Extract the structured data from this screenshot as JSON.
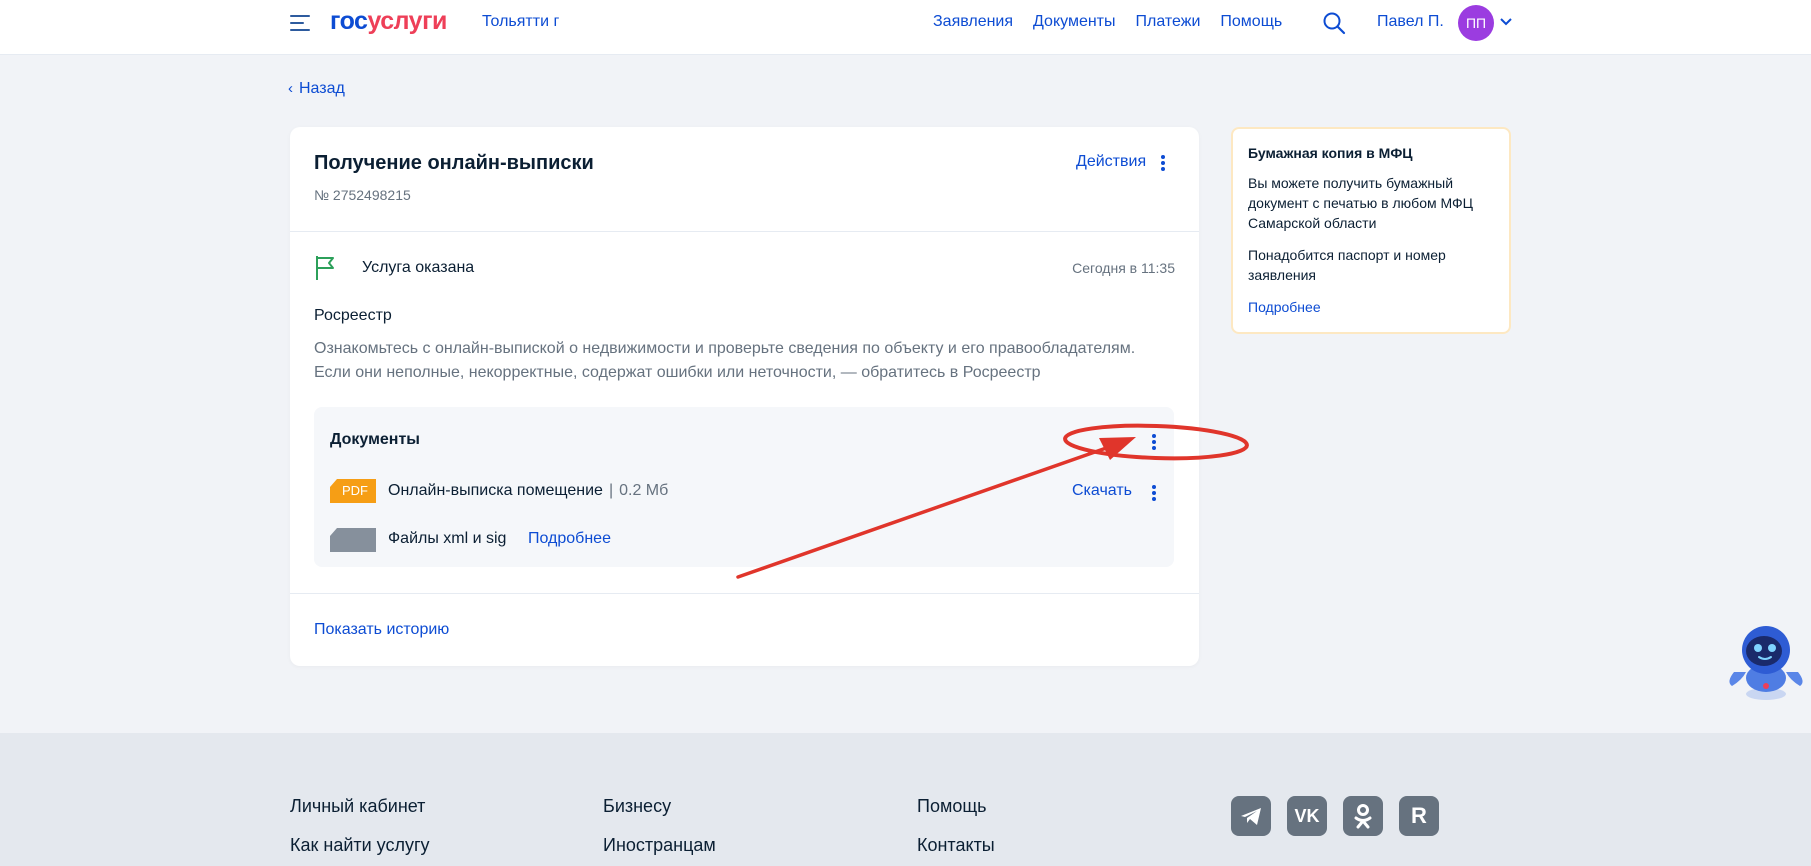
{
  "header": {
    "logo_part1": "гос",
    "logo_part2": "услуги",
    "city": "Тольятти г",
    "nav": [
      "Заявления",
      "Документы",
      "Платежи",
      "Помощь"
    ],
    "user_name": "Павел П.",
    "avatar_initials": "ПП"
  },
  "back_label": "Назад",
  "card": {
    "title": "Получение онлайн-выписки",
    "number": "№ 2752498215",
    "actions_label": "Действия",
    "status": "Услуга оказана",
    "status_time": "Сегодня в 11:35",
    "organization": "Росреестр",
    "description": "Ознакомьтесь с онлайн-выпиской о недвижимости и проверьте сведения по объекту и его правообладателям. Если они неполные, некорректные, содержат ошибки или неточности, — обратитесь в Росреестр",
    "documents": {
      "title": "Документы",
      "file_badge": "PDF",
      "file_name": "Онлайн-выписка помещение",
      "file_sep": "|",
      "file_size": "0.2 Мб",
      "download_label": "Скачать",
      "files_label": "Файлы xml и sig",
      "files_more": "Подробнее"
    },
    "history_label": "Показать историю"
  },
  "side": {
    "title": "Бумажная копия в МФЦ",
    "p1": "Вы можете получить бумажный документ с печатью в любом МФЦ Самарской области",
    "p2": "Понадобится паспорт и номер заявления",
    "more": "Подробнее"
  },
  "footer": {
    "col1": [
      "Личный кабинет",
      "Как найти услугу"
    ],
    "col2": [
      "Бизнесу",
      "Иностранцам"
    ],
    "col3": [
      "Помощь",
      "Контакты"
    ],
    "social": [
      "telegram-icon",
      "vk-icon",
      "ok-icon",
      "rutube-icon"
    ]
  },
  "colors": {
    "accent": "#0d4cd3",
    "logo_red": "#ee3f58",
    "status_green": "#2ca05a",
    "annotation_red": "#e0352b",
    "pdf_orange": "#f69e15"
  }
}
